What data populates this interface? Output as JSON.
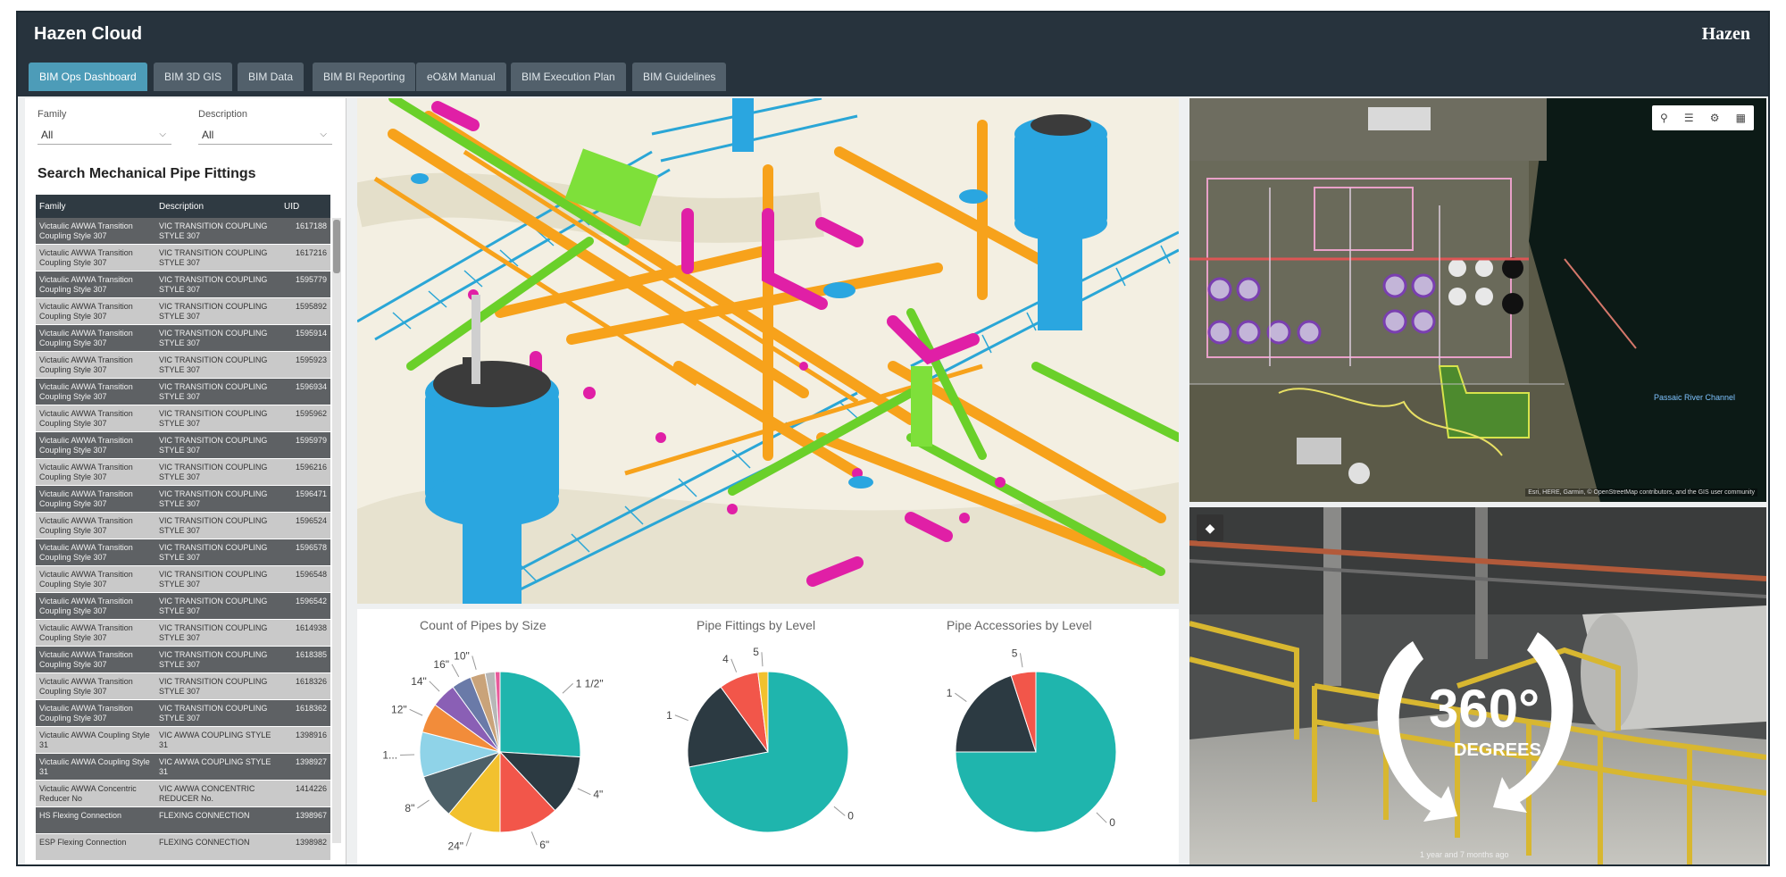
{
  "header": {
    "app_title": "Hazen Cloud",
    "brand": "Hazen"
  },
  "tabs": [
    {
      "label": "BIM Ops Dashboard",
      "active": true
    },
    {
      "label": "BIM 3D GIS",
      "active": false
    },
    {
      "label": "BIM Data",
      "active": false
    },
    {
      "label": "BIM BI Reporting",
      "active": false
    },
    {
      "label": "eO&M Manual",
      "active": false
    },
    {
      "label": "BIM Execution Plan",
      "active": false
    },
    {
      "label": "BIM Guidelines",
      "active": false
    }
  ],
  "filters": {
    "family_label": "Family",
    "family_value": "All",
    "description_label": "Description",
    "description_value": "All"
  },
  "search": {
    "title": "Search Mechanical Pipe Fittings",
    "columns": [
      "Family",
      "Description",
      "UID"
    ],
    "rows": [
      {
        "family": "Victaulic AWWA Transition Coupling Style 307",
        "description": "VIC TRANSITION COUPLING STYLE 307",
        "uid": "1617188"
      },
      {
        "family": "Victaulic AWWA Transition Coupling Style 307",
        "description": "VIC TRANSITION COUPLING STYLE 307",
        "uid": "1617216"
      },
      {
        "family": "Victaulic AWWA Transition Coupling Style 307",
        "description": "VIC TRANSITION COUPLING STYLE 307",
        "uid": "1595779"
      },
      {
        "family": "Victaulic AWWA Transition Coupling Style 307",
        "description": "VIC TRANSITION COUPLING STYLE 307",
        "uid": "1595892"
      },
      {
        "family": "Victaulic AWWA Transition Coupling Style 307",
        "description": "VIC TRANSITION COUPLING STYLE 307",
        "uid": "1595914"
      },
      {
        "family": "Victaulic AWWA Transition Coupling Style 307",
        "description": "VIC TRANSITION COUPLING STYLE 307",
        "uid": "1595923"
      },
      {
        "family": "Victaulic AWWA Transition Coupling Style 307",
        "description": "VIC TRANSITION COUPLING STYLE 307",
        "uid": "1596934"
      },
      {
        "family": "Victaulic AWWA Transition Coupling Style 307",
        "description": "VIC TRANSITION COUPLING STYLE 307",
        "uid": "1595962"
      },
      {
        "family": "Victaulic AWWA Transition Coupling Style 307",
        "description": "VIC TRANSITION COUPLING STYLE 307",
        "uid": "1595979"
      },
      {
        "family": "Victaulic AWWA Transition Coupling Style 307",
        "description": "VIC TRANSITION COUPLING STYLE 307",
        "uid": "1596216"
      },
      {
        "family": "Victaulic AWWA Transition Coupling Style 307",
        "description": "VIC TRANSITION COUPLING STYLE 307",
        "uid": "1596471"
      },
      {
        "family": "Victaulic AWWA Transition Coupling Style 307",
        "description": "VIC TRANSITION COUPLING STYLE 307",
        "uid": "1596524"
      },
      {
        "family": "Victaulic AWWA Transition Coupling Style 307",
        "description": "VIC TRANSITION COUPLING STYLE 307",
        "uid": "1596578"
      },
      {
        "family": "Victaulic AWWA Transition Coupling Style 307",
        "description": "VIC TRANSITION COUPLING STYLE 307",
        "uid": "1596548"
      },
      {
        "family": "Victaulic AWWA Transition Coupling Style 307",
        "description": "VIC TRANSITION COUPLING STYLE 307",
        "uid": "1596542"
      },
      {
        "family": "Victaulic AWWA Transition Coupling Style 307",
        "description": "VIC TRANSITION COUPLING STYLE 307",
        "uid": "1614938"
      },
      {
        "family": "Victaulic AWWA Transition Coupling Style 307",
        "description": "VIC TRANSITION COUPLING STYLE 307",
        "uid": "1618385"
      },
      {
        "family": "Victaulic AWWA Transition Coupling Style 307",
        "description": "VIC TRANSITION COUPLING STYLE 307",
        "uid": "1618326"
      },
      {
        "family": "Victaulic AWWA Transition Coupling Style 307",
        "description": "VIC TRANSITION COUPLING STYLE 307",
        "uid": "1618362"
      },
      {
        "family": "Victaulic AWWA Coupling Style 31",
        "description": "VIC AWWA COUPLING STYLE 31",
        "uid": "1398916"
      },
      {
        "family": "Victaulic AWWA Coupling Style 31",
        "description": "VIC AWWA COUPLING STYLE 31",
        "uid": "1398927"
      },
      {
        "family": "Victaulic AWWA Concentric Reducer No",
        "description": "VIC AWWA CONCENTRIC REDUCER No.",
        "uid": "1414226"
      },
      {
        "family": "HS Flexing Connection",
        "description": "FLEXING CONNECTION",
        "uid": "1398967"
      },
      {
        "family": "ESP Flexing Connection",
        "description": "FLEXING CONNECTION",
        "uid": "1398982"
      }
    ]
  },
  "chart_data": [
    {
      "type": "pie",
      "title": "Count of Pipes by Size",
      "slices": [
        {
          "label": "1 1/2\"",
          "value": 26,
          "color": "#1fb5ad"
        },
        {
          "label": "4\"",
          "value": 12,
          "color": "#2c3a42"
        },
        {
          "label": "6\"",
          "value": 12,
          "color": "#f2564a"
        },
        {
          "label": "24\"",
          "value": 11,
          "color": "#f2c12e"
        },
        {
          "label": "8\"",
          "value": 9,
          "color": "#4d6068"
        },
        {
          "label": "1...",
          "value": 9,
          "color": "#8fd3e8"
        },
        {
          "label": "12\"",
          "value": 6,
          "color": "#f28c3a"
        },
        {
          "label": "14\"",
          "value": 5,
          "color": "#8a5fb5"
        },
        {
          "label": "16\"",
          "value": 4,
          "color": "#6a7aa8"
        },
        {
          "label": "10\"",
          "value": 3,
          "color": "#c9a37a"
        },
        {
          "label": "",
          "value": 2,
          "color": "#b7b7b7"
        },
        {
          "label": "",
          "value": 1,
          "color": "#e85a9a"
        }
      ]
    },
    {
      "type": "pie",
      "title": "Pipe Fittings by Level",
      "slices": [
        {
          "label": "0",
          "value": 72,
          "color": "#1fb5ad"
        },
        {
          "label": "1",
          "value": 18,
          "color": "#2c3a42"
        },
        {
          "label": "4",
          "value": 8,
          "color": "#f2564a"
        },
        {
          "label": "5",
          "value": 2,
          "color": "#f2c12e"
        }
      ]
    },
    {
      "type": "pie",
      "title": "Pipe Accessories by Level",
      "slices": [
        {
          "label": "0",
          "value": 75,
          "color": "#1fb5ad"
        },
        {
          "label": "1",
          "value": 20,
          "color": "#2c3a42"
        },
        {
          "label": "5",
          "value": 5,
          "color": "#f2564a"
        }
      ]
    }
  ],
  "map": {
    "tool_icons": [
      "search-icon",
      "list-icon",
      "settings-icon",
      "grid-icon"
    ],
    "place_label": "Passaic River Channel",
    "attribution": "Esri, HERE, Garmin, © OpenStreetMap contributors, and the GIS user community"
  },
  "pano": {
    "badge_number": "360°",
    "badge_text": "DEGREES",
    "caption": "1 year and 7 months ago"
  }
}
